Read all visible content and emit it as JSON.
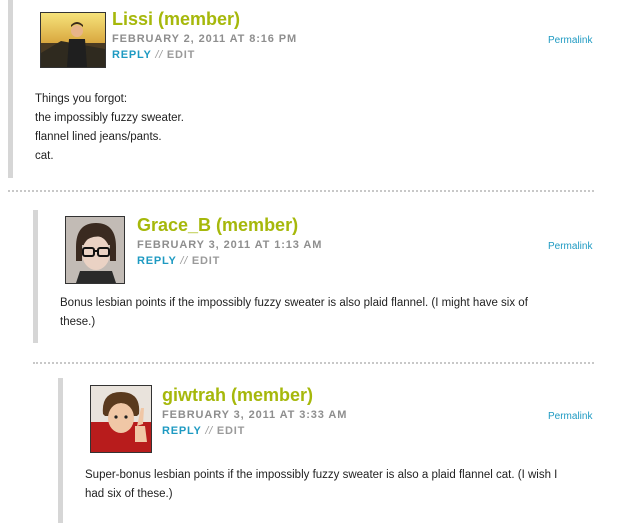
{
  "comments": [
    {
      "author": "Lissi (member)",
      "date": "FEBRUARY 2, 2011 AT 8:16 PM",
      "reply_label": "REPLY",
      "separator": "//",
      "edit_label": "EDIT",
      "permalink_label": "Permalink",
      "body_lines": [
        "Things you forgot:",
        "the impossibly fuzzy sweater.",
        "flannel lined jeans/pants.",
        "cat."
      ]
    },
    {
      "author": "Grace_B (member)",
      "date": "FEBRUARY 3, 2011 AT 1:13 AM",
      "reply_label": "REPLY",
      "separator": "//",
      "edit_label": "EDIT",
      "permalink_label": "Permalink",
      "body_lines": [
        "Bonus lesbian points if the impossibly fuzzy sweater is also plaid flannel. (I might have six of",
        "these.)"
      ]
    },
    {
      "author": "giwtrah (member)",
      "date": "FEBRUARY 3, 2011 AT 3:33 AM",
      "reply_label": "REPLY",
      "separator": "//",
      "edit_label": "EDIT",
      "permalink_label": "Permalink",
      "body_lines": [
        "Super-bonus lesbian points if the impossibly fuzzy sweater is also a plaid flannel cat. (I wish I",
        "had six of these.)"
      ]
    }
  ],
  "colors": {
    "author": "#a6b80b",
    "link": "#1e9ac2",
    "meta": "#8e8e8e",
    "bar": "#d6d6d6"
  }
}
